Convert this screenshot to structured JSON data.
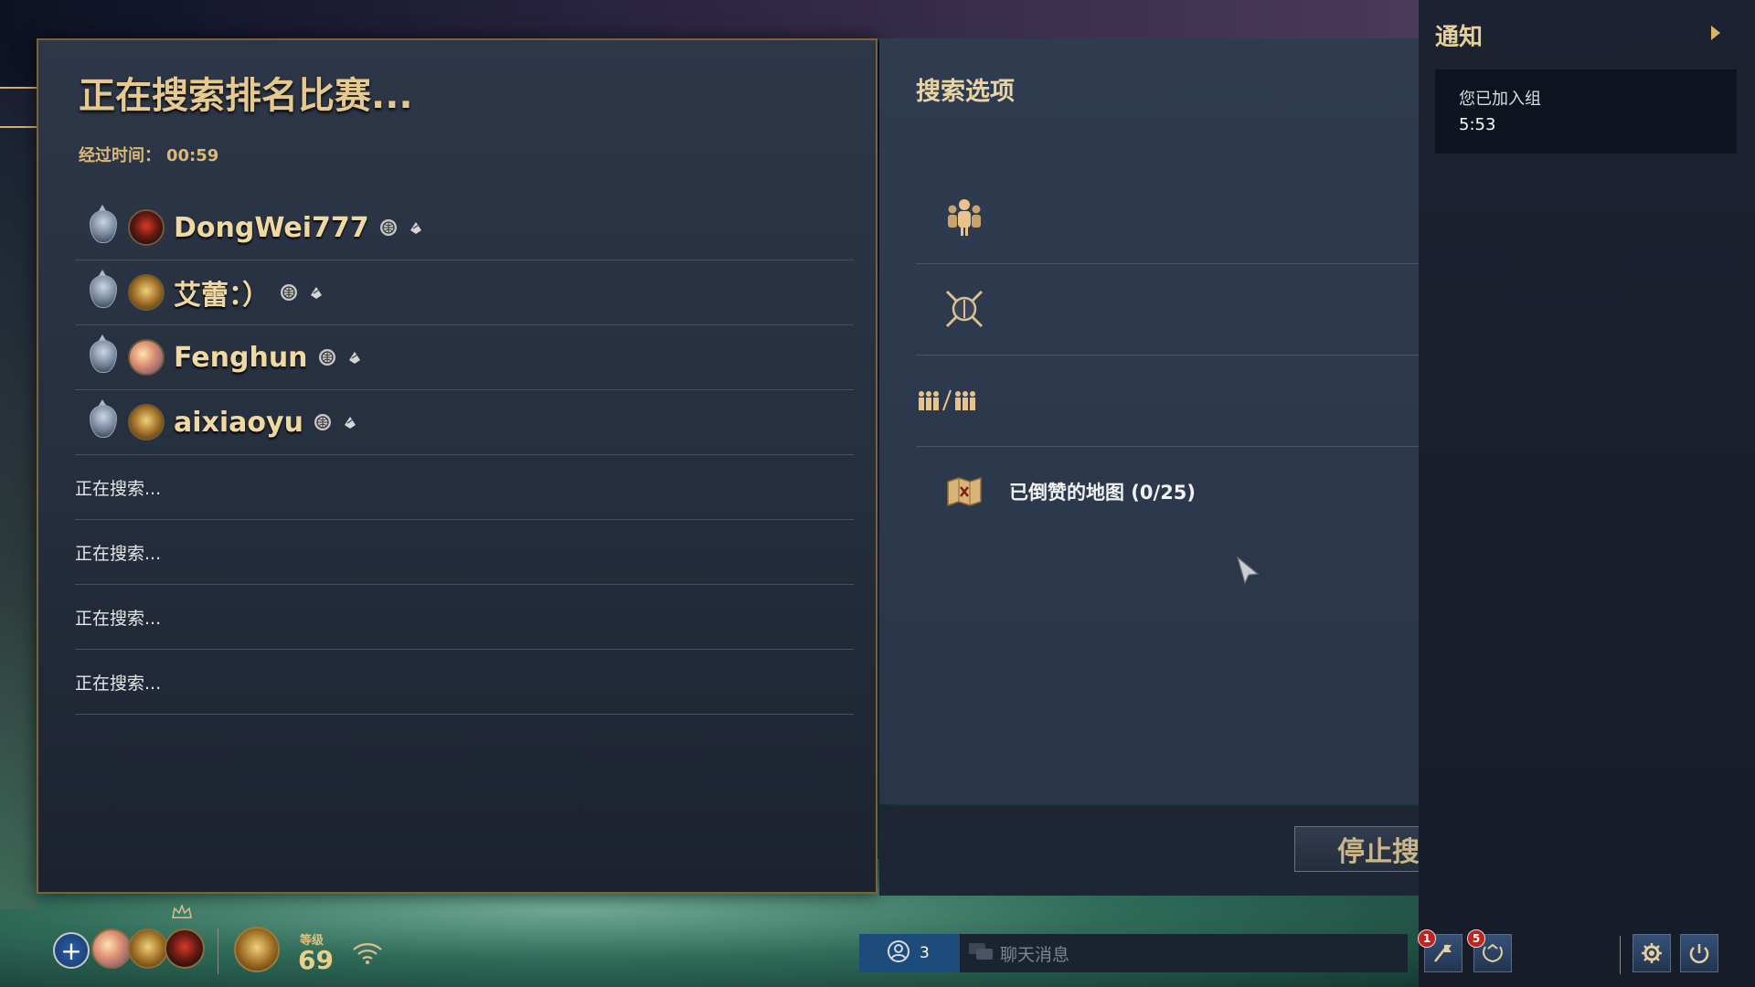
{
  "main": {
    "title": "正在搜索排名比赛...",
    "elapsed_label": "经过时间：",
    "elapsed_value": "00:59",
    "players": [
      {
        "name": "DongWei777"
      },
      {
        "name": "艾蕾：）"
      },
      {
        "name": "Fenghun"
      },
      {
        "name": "aixiaoyu"
      }
    ],
    "searching_slots": [
      "正在搜索...",
      "正在搜索...",
      "正在搜索...",
      "正在搜索..."
    ]
  },
  "options": {
    "title": "搜索选项",
    "rows": [
      {
        "icon": "team-icon",
        "label": ""
      },
      {
        "icon": "crossed-swords-icon",
        "label": ""
      },
      {
        "icon": "team-vs-team-icon",
        "label": ""
      },
      {
        "icon": "map-icon",
        "label": "已倒赞的地图 (0/25)"
      }
    ],
    "stop_button": "停止搜"
  },
  "notifications": {
    "title": "通知",
    "items": [
      {
        "message": "您已加入组",
        "time": "5:53"
      }
    ]
  },
  "bottom_bar": {
    "level_label": "等级",
    "level_value": "69",
    "friends_count": "3",
    "chat_placeholder": "聊天消息",
    "badge_1": "1",
    "badge_2": "5"
  },
  "colors": {
    "accent_gold": "#e6c98f",
    "panel_bg": "#2d3748",
    "notif_bg": "#1c2231",
    "friends_blue": "#1d4b7a",
    "badge_red": "#c0241c"
  }
}
